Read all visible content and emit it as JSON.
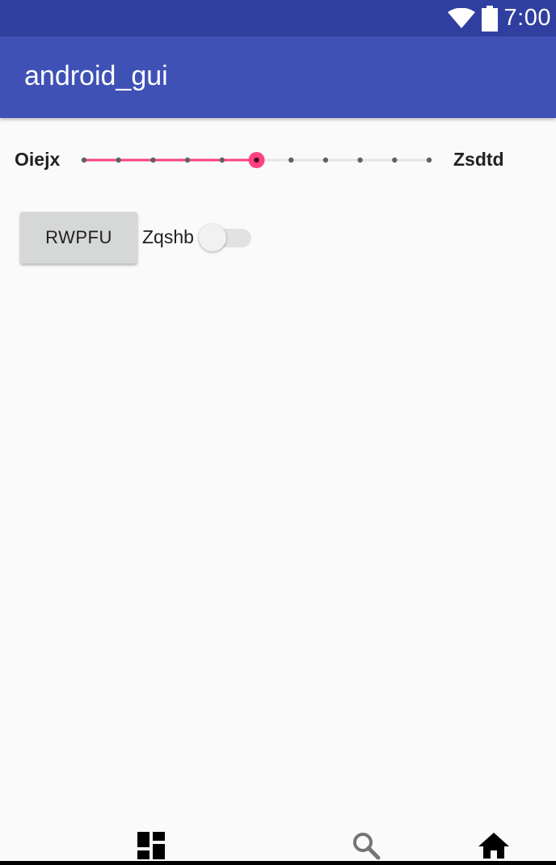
{
  "status_bar": {
    "time": "7:00",
    "icons": [
      "wifi-icon",
      "battery-icon"
    ]
  },
  "app_bar": {
    "title": "android_gui"
  },
  "seekbar": {
    "min_label": "Oiejx",
    "max_label": "Zsdtd",
    "steps": 11,
    "current_step": 5,
    "accent_color": "#ff4081"
  },
  "button": {
    "label": "RWPFU"
  },
  "switch": {
    "label": "Zqshb",
    "checked": false
  },
  "bottom_nav": {
    "items": [
      {
        "icon": "dashboard-icon"
      },
      {
        "icon": "search-icon"
      },
      {
        "icon": "home-icon"
      }
    ]
  },
  "colors": {
    "status_bar": "#303f9f",
    "app_bar": "#3f51b5",
    "background": "#fafafa",
    "accent": "#ff4081"
  }
}
